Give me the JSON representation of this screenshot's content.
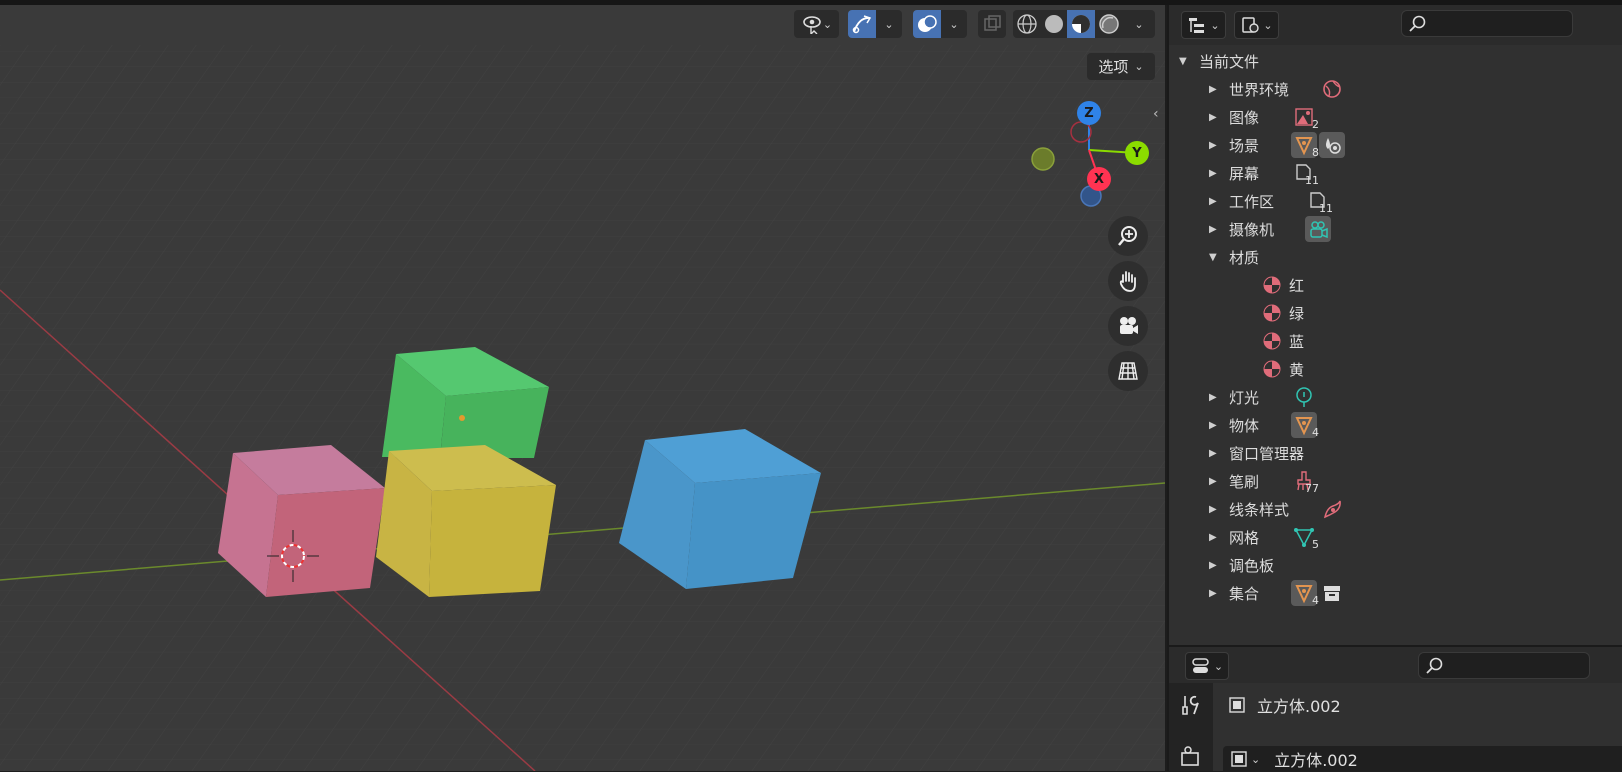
{
  "viewport": {
    "options_label": "选项",
    "gizmo": {
      "z": "Z",
      "y": "Y",
      "x": "X"
    },
    "header_icons": [
      "selectability-icon",
      "gizmo-icon",
      "overlay-icon",
      "xray-icon",
      "wireframe-shading-icon",
      "solid-shading-icon",
      "material-preview-icon",
      "rendered-shading-icon"
    ],
    "nav_icons": [
      "zoom-icon",
      "pan-hand-icon",
      "camera-view-icon",
      "perspective-grid-icon"
    ],
    "objects": [
      {
        "name": "pink-cube",
        "color": "#c46e8a"
      },
      {
        "name": "green-cube",
        "color": "#4db862"
      },
      {
        "name": "yellow-cube",
        "color": "#c9b744"
      },
      {
        "name": "blue-cube",
        "color": "#4a98cb"
      }
    ]
  },
  "outliner": {
    "root": "当前文件",
    "items": [
      {
        "label": "世界环境",
        "icon": "world-icon",
        "count": "",
        "expanded": false
      },
      {
        "label": "图像",
        "icon": "image-icon",
        "count": "2",
        "expanded": false
      },
      {
        "label": "场景",
        "icon": "scene-icon",
        "count": "8",
        "expanded": false
      },
      {
        "label": "屏幕",
        "icon": "screen-icon",
        "count": "11",
        "expanded": false
      },
      {
        "label": "工作区",
        "icon": "workspace-icon",
        "count": "11",
        "expanded": false
      },
      {
        "label": "摄像机",
        "icon": "camera-data-icon",
        "count": "",
        "expanded": false
      },
      {
        "label": "材质",
        "icon": "",
        "count": "",
        "expanded": true
      },
      {
        "label": "红",
        "icon": "material-icon",
        "count": "",
        "child": true
      },
      {
        "label": "绿",
        "icon": "material-icon",
        "count": "",
        "child": true
      },
      {
        "label": "蓝",
        "icon": "material-icon",
        "count": "",
        "child": true
      },
      {
        "label": "黄",
        "icon": "material-icon",
        "count": "",
        "child": true
      },
      {
        "label": "灯光",
        "icon": "light-icon",
        "count": "",
        "expanded": false
      },
      {
        "label": "物体",
        "icon": "object-icon",
        "count": "4",
        "expanded": false
      },
      {
        "label": "窗口管理器",
        "icon": "",
        "count": "",
        "expanded": false
      },
      {
        "label": "笔刷",
        "icon": "brush-icon",
        "count": "77",
        "expanded": false
      },
      {
        "label": "线条样式",
        "icon": "linestyle-icon",
        "count": "",
        "expanded": false
      },
      {
        "label": "网格",
        "icon": "mesh-icon",
        "count": "5",
        "expanded": false
      },
      {
        "label": "调色板",
        "icon": "",
        "count": "",
        "expanded": false
      },
      {
        "label": "集合",
        "icon": "collection-icon",
        "count": "4",
        "expanded": false
      }
    ]
  },
  "properties": {
    "title": "立方体.002",
    "field_value": "立方体.002"
  },
  "colors": {
    "accent": "#4772b3",
    "axis_x": "#ff3352",
    "axis_y": "#8bdc00",
    "axis_z": "#2f83e8",
    "material": "#e06c7a",
    "object": "#e39550",
    "teal": "#30c5b3"
  }
}
